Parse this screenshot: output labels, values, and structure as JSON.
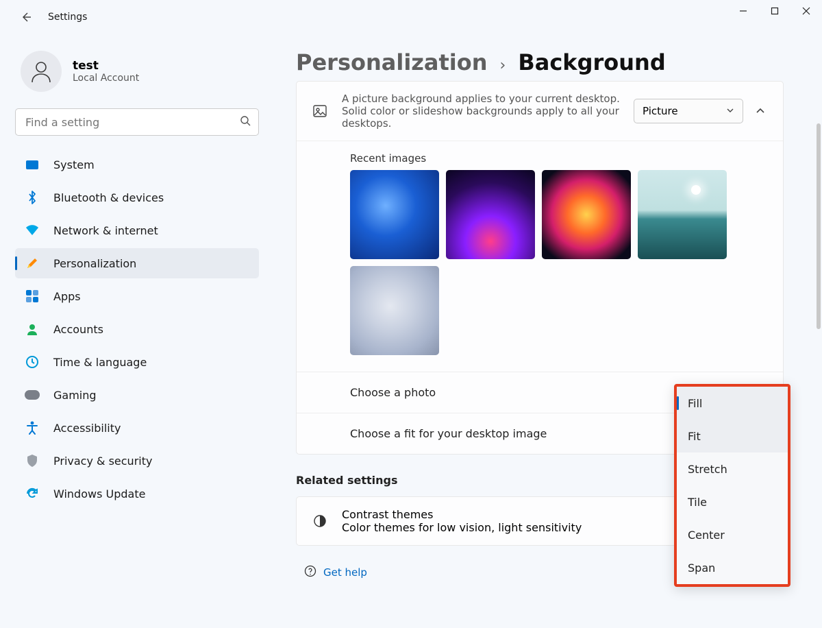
{
  "window": {
    "title": "Settings"
  },
  "account": {
    "name": "test",
    "sub": "Local Account"
  },
  "search": {
    "placeholder": "Find a setting"
  },
  "nav": [
    {
      "id": "system",
      "label": "System"
    },
    {
      "id": "bluetooth",
      "label": "Bluetooth & devices"
    },
    {
      "id": "network",
      "label": "Network & internet"
    },
    {
      "id": "personalization",
      "label": "Personalization",
      "selected": true
    },
    {
      "id": "apps",
      "label": "Apps"
    },
    {
      "id": "accounts",
      "label": "Accounts"
    },
    {
      "id": "time",
      "label": "Time & language"
    },
    {
      "id": "gaming",
      "label": "Gaming"
    },
    {
      "id": "accessibility",
      "label": "Accessibility"
    },
    {
      "id": "privacy",
      "label": "Privacy & security"
    },
    {
      "id": "update",
      "label": "Windows Update"
    }
  ],
  "breadcrumbs": {
    "parent": "Personalization",
    "current": "Background"
  },
  "background_card": {
    "desc": "A picture background applies to your current desktop. Solid color or slideshow backgrounds apply to all your desktops.",
    "select_value": "Picture",
    "recent_label": "Recent images",
    "choose_photo_label": "Choose a photo",
    "choose_fit_label": "Choose a fit for your desktop image"
  },
  "related": {
    "heading": "Related settings",
    "contrast_title": "Contrast themes",
    "contrast_sub": "Color themes for low vision, light sensitivity"
  },
  "help": {
    "label": "Get help"
  },
  "fit_dropdown": {
    "options": [
      "Fill",
      "Fit",
      "Stretch",
      "Tile",
      "Center",
      "Span"
    ],
    "selected": "Fill",
    "hover": "Fit"
  }
}
